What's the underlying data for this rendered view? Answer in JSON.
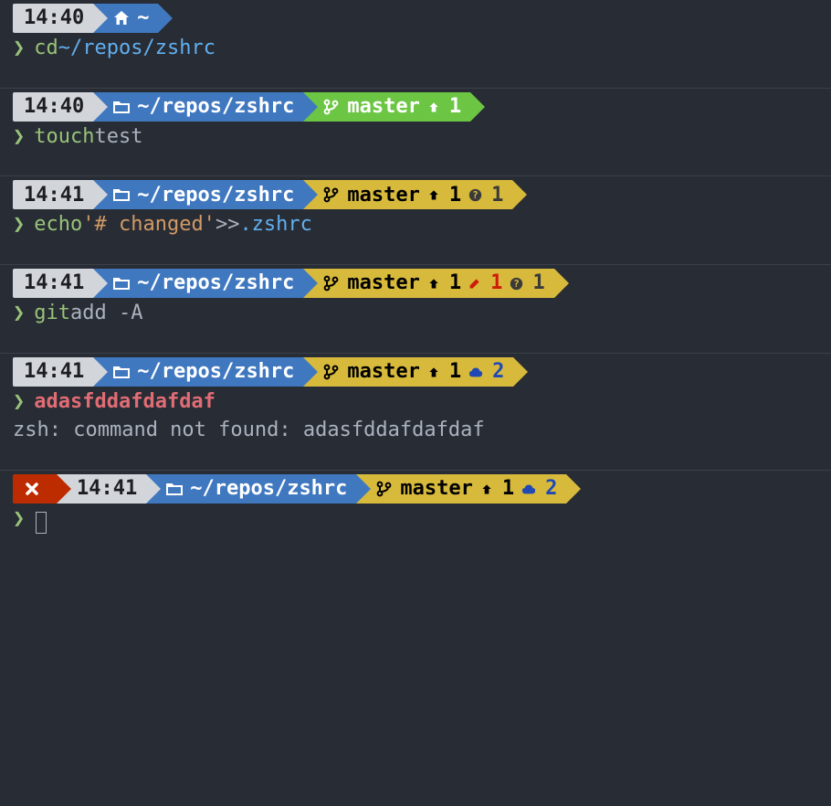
{
  "colors": {
    "bg": "#282c34",
    "segment_grey": "#d2d6db",
    "segment_blue": "#4078c0",
    "segment_green": "#6cc644",
    "segment_yellow": "#d7ba3c",
    "segment_red": "#bd2c00",
    "text": "#abb2bf",
    "cmd_green": "#98c379",
    "cmd_blue": "#61afef",
    "cmd_orange": "#d19a66",
    "cmd_red": "#e06c75"
  },
  "icons": {
    "home": "home-icon",
    "folder": "folder-icon",
    "branch": "git-branch-icon",
    "error": "x-icon",
    "ahead": "arrow-up-icon",
    "untracked": "question-icon",
    "modified": "pencil-icon",
    "staged": "cloud-icon"
  },
  "blocks": [
    {
      "error": false,
      "time": "14:40",
      "path_icon": "home",
      "path": "~",
      "git": null,
      "command": {
        "tokens": [
          {
            "cls": "cmd",
            "t": "cd"
          },
          {
            "cls": "path",
            "t": " ~/repos/zshrc"
          }
        ]
      },
      "output": null
    },
    {
      "error": false,
      "time": "14:40",
      "path_icon": "folder",
      "path": "~/repos/zshrc",
      "git": {
        "color": "green",
        "branch": "master",
        "ahead": "1",
        "untracked": null,
        "modified": null,
        "staged": null
      },
      "command": {
        "tokens": [
          {
            "cls": "cmd",
            "t": "touch"
          },
          {
            "cls": "plain",
            "t": " test"
          }
        ]
      },
      "output": null
    },
    {
      "error": false,
      "time": "14:41",
      "path_icon": "folder",
      "path": "~/repos/zshrc",
      "git": {
        "color": "yellow",
        "branch": "master",
        "ahead": "1",
        "untracked": "1",
        "modified": null,
        "staged": null
      },
      "command": {
        "tokens": [
          {
            "cls": "cmd",
            "t": "echo"
          },
          {
            "cls": "str",
            "t": " '# changed'"
          },
          {
            "cls": "plain",
            "t": " >> "
          },
          {
            "cls": "path",
            "t": ".zshrc"
          }
        ]
      },
      "output": null
    },
    {
      "error": false,
      "time": "14:41",
      "path_icon": "folder",
      "path": "~/repos/zshrc",
      "git": {
        "color": "yellow",
        "branch": "master",
        "ahead": "1",
        "untracked": "1",
        "modified": "1",
        "staged": null
      },
      "command": {
        "tokens": [
          {
            "cls": "cmd",
            "t": "git"
          },
          {
            "cls": "plain",
            "t": " add -A"
          }
        ]
      },
      "output": null
    },
    {
      "error": false,
      "time": "14:41",
      "path_icon": "folder",
      "path": "~/repos/zshrc",
      "git": {
        "color": "yellow",
        "branch": "master",
        "ahead": "1",
        "untracked": null,
        "modified": null,
        "staged": "2"
      },
      "command": {
        "tokens": [
          {
            "cls": "err",
            "t": "adasfddafdafdaf"
          }
        ]
      },
      "output": "zsh: command not found: adasfddafdafdaf"
    },
    {
      "error": true,
      "time": "14:41",
      "path_icon": "folder",
      "path": "~/repos/zshrc",
      "git": {
        "color": "yellow",
        "branch": "master",
        "ahead": "1",
        "untracked": null,
        "modified": null,
        "staged": "2"
      },
      "command": {
        "cursor": true,
        "tokens": []
      },
      "output": null
    }
  ]
}
